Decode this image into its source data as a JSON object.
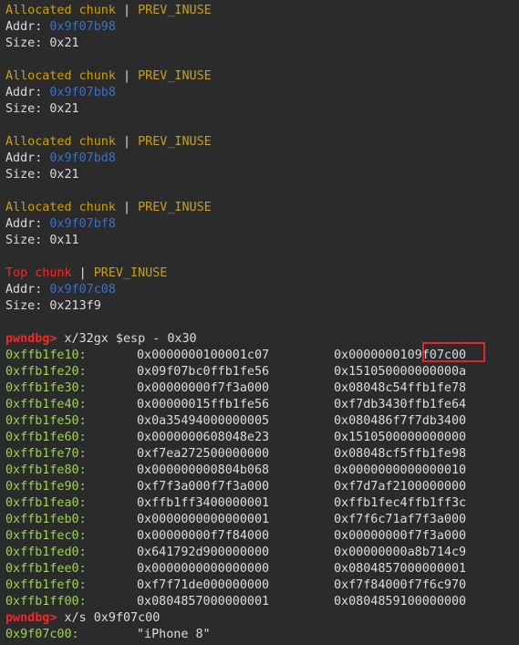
{
  "chunks": [
    {
      "type": "Allocated chunk",
      "sep": " | ",
      "flag": "PREV_INUSE",
      "addr_label": "Addr: ",
      "addr": "0x9f07b98",
      "size_label": "Size: ",
      "size": "0x21",
      "type_color": "#c8a017"
    },
    {
      "type": "Allocated chunk",
      "sep": " | ",
      "flag": "PREV_INUSE",
      "addr_label": "Addr: ",
      "addr": "0x9f07bb8",
      "size_label": "Size: ",
      "size": "0x21",
      "type_color": "#c8a017"
    },
    {
      "type": "Allocated chunk",
      "sep": " | ",
      "flag": "PREV_INUSE",
      "addr_label": "Addr: ",
      "addr": "0x9f07bd8",
      "size_label": "Size: ",
      "size": "0x21",
      "type_color": "#c8a017"
    },
    {
      "type": "Allocated chunk",
      "sep": " | ",
      "flag": "PREV_INUSE",
      "addr_label": "Addr: ",
      "addr": "0x9f07bf8",
      "size_label": "Size: ",
      "size": "0x11",
      "type_color": "#c8a017"
    },
    {
      "type": "Top chunk",
      "sep": " | ",
      "flag": "PREV_INUSE",
      "addr_label": "Addr: ",
      "addr": "0x9f07c08",
      "size_label": "Size: ",
      "size": "0x213f9",
      "type_color": "#ef2929"
    }
  ],
  "cmd1": {
    "prompt": "pwndbg> ",
    "command": "x/32gx $esp - 0x30"
  },
  "memory_rows": [
    {
      "addr": "0xffb1fe10:",
      "v1": "0x0000000100001c07",
      "v2": "0x000000010",
      "v2_hl": "9f07c00"
    },
    {
      "addr": "0xffb1fe20:",
      "v1": "0x09f07bc0ffb1fe56",
      "v2": "0x151050000000000a",
      "v2_hl": ""
    },
    {
      "addr": "0xffb1fe30:",
      "v1": "0x00000000f7f3a000",
      "v2": "0x08048c54ffb1fe78",
      "v2_hl": ""
    },
    {
      "addr": "0xffb1fe40:",
      "v1": "0x00000015ffb1fe56",
      "v2": "0xf7db3430ffb1fe64",
      "v2_hl": ""
    },
    {
      "addr": "0xffb1fe50:",
      "v1": "0x0a35494000000005",
      "v2": "0x080486f7f7db3400",
      "v2_hl": ""
    },
    {
      "addr": "0xffb1fe60:",
      "v1": "0x0000000608048e23",
      "v2": "0x1510500000000000",
      "v2_hl": ""
    },
    {
      "addr": "0xffb1fe70:",
      "v1": "0xf7ea272500000000",
      "v2": "0x08048cf5ffb1fe98",
      "v2_hl": ""
    },
    {
      "addr": "0xffb1fe80:",
      "v1": "0x000000000804b068",
      "v2": "0x0000000000000010",
      "v2_hl": ""
    },
    {
      "addr": "0xffb1fe90:",
      "v1": "0xf7f3a000f7f3a000",
      "v2": "0xf7d7af2100000000",
      "v2_hl": ""
    },
    {
      "addr": "0xffb1fea0:",
      "v1": "0xffb1ff3400000001",
      "v2": "0xffb1fec4ffb1ff3c",
      "v2_hl": ""
    },
    {
      "addr": "0xffb1feb0:",
      "v1": "0x0000000000000001",
      "v2": "0xf7f6c71af7f3a000",
      "v2_hl": ""
    },
    {
      "addr": "0xffb1fec0:",
      "v1": "0x00000000f7f84000",
      "v2": "0x00000000f7f3a000",
      "v2_hl": ""
    },
    {
      "addr": "0xffb1fed0:",
      "v1": "0x641792d900000000",
      "v2": "0x00000000a8b714c9",
      "v2_hl": ""
    },
    {
      "addr": "0xffb1fee0:",
      "v1": "0x0000000000000000",
      "v2": "0x0804857000000001",
      "v2_hl": ""
    },
    {
      "addr": "0xffb1fef0:",
      "v1": "0xf7f71de000000000",
      "v2": "0xf7f84000f7f6c970",
      "v2_hl": ""
    },
    {
      "addr": "0xffb1ff00:",
      "v1": "0x0804857000000001",
      "v2": "0x0804859100000000",
      "v2_hl": ""
    }
  ],
  "cmd2": {
    "prompt": "pwndbg> ",
    "command": "x/s 0x9f07c00"
  },
  "string_result": {
    "addr": "0x9f07c00:",
    "value": "\"iPhone 8\""
  }
}
